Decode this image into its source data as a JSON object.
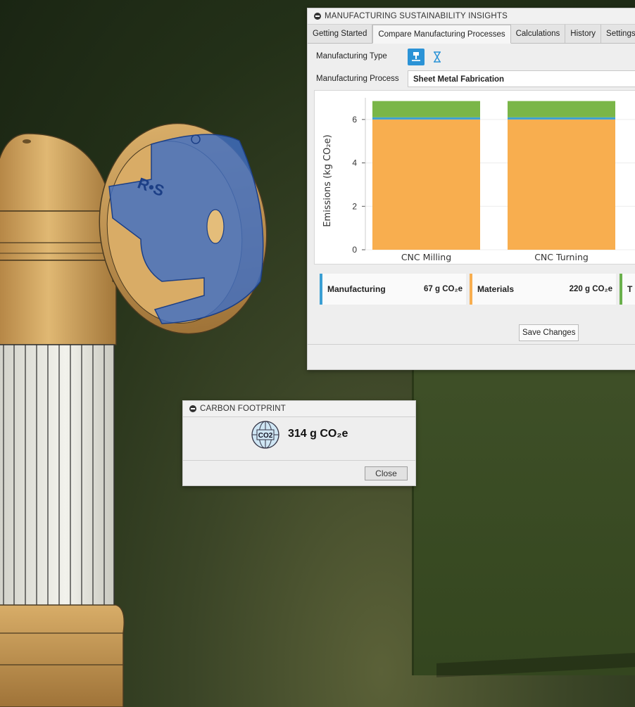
{
  "sustainability_panel": {
    "title": "MANUFACTURING SUSTAINABILITY INSIGHTS",
    "tabs": [
      {
        "label": "Getting Started"
      },
      {
        "label": "Compare Manufacturing Processes",
        "active": true
      },
      {
        "label": "Calculations"
      },
      {
        "label": "History"
      },
      {
        "label": "Settings"
      }
    ],
    "manufacturing_type_label": "Manufacturing Type",
    "manufacturing_type_icons": [
      "milling-machine-icon",
      "additive-hourglass-icon"
    ],
    "manufacturing_process_label": "Manufacturing Process",
    "manufacturing_process_value": "Sheet Metal Fabrication",
    "legend": [
      {
        "label": "Manufacturing",
        "value": "67 g CO₂e",
        "color": "#3b9fd3"
      },
      {
        "label": "Materials",
        "value": "220 g CO₂e",
        "color": "#f8ae4f"
      },
      {
        "label": "T",
        "value": "",
        "color": "#6ab04c"
      }
    ],
    "save_label": "Save Changes"
  },
  "chart_data": {
    "type": "bar",
    "stacked": true,
    "categories": [
      "CNC Milling",
      "CNC Turning"
    ],
    "series": [
      {
        "values": [
          6.0,
          6.0
        ],
        "color": "#f8ae4f"
      },
      {
        "values": [
          0.1,
          0.1
        ],
        "color": "#3b9fd3"
      },
      {
        "values": [
          0.75,
          0.75
        ],
        "color": "#7ab648"
      }
    ],
    "ylabel": "Emissions (kg CO₂e)",
    "y_ticks": [
      0,
      2,
      4,
      6
    ],
    "ylim": [
      0,
      7
    ],
    "partial_third_bar_color": "#8fd0f2"
  },
  "carbon_footprint": {
    "title": "CARBON FOOTPRINT",
    "icon_text": "CO2",
    "value": "314 g CO₂e",
    "close_label": "Close"
  },
  "colors": {
    "accent_blue": "#2b93d6",
    "part_brass": "#c89a55",
    "part_blue_highlight": "#3f6fc4"
  }
}
